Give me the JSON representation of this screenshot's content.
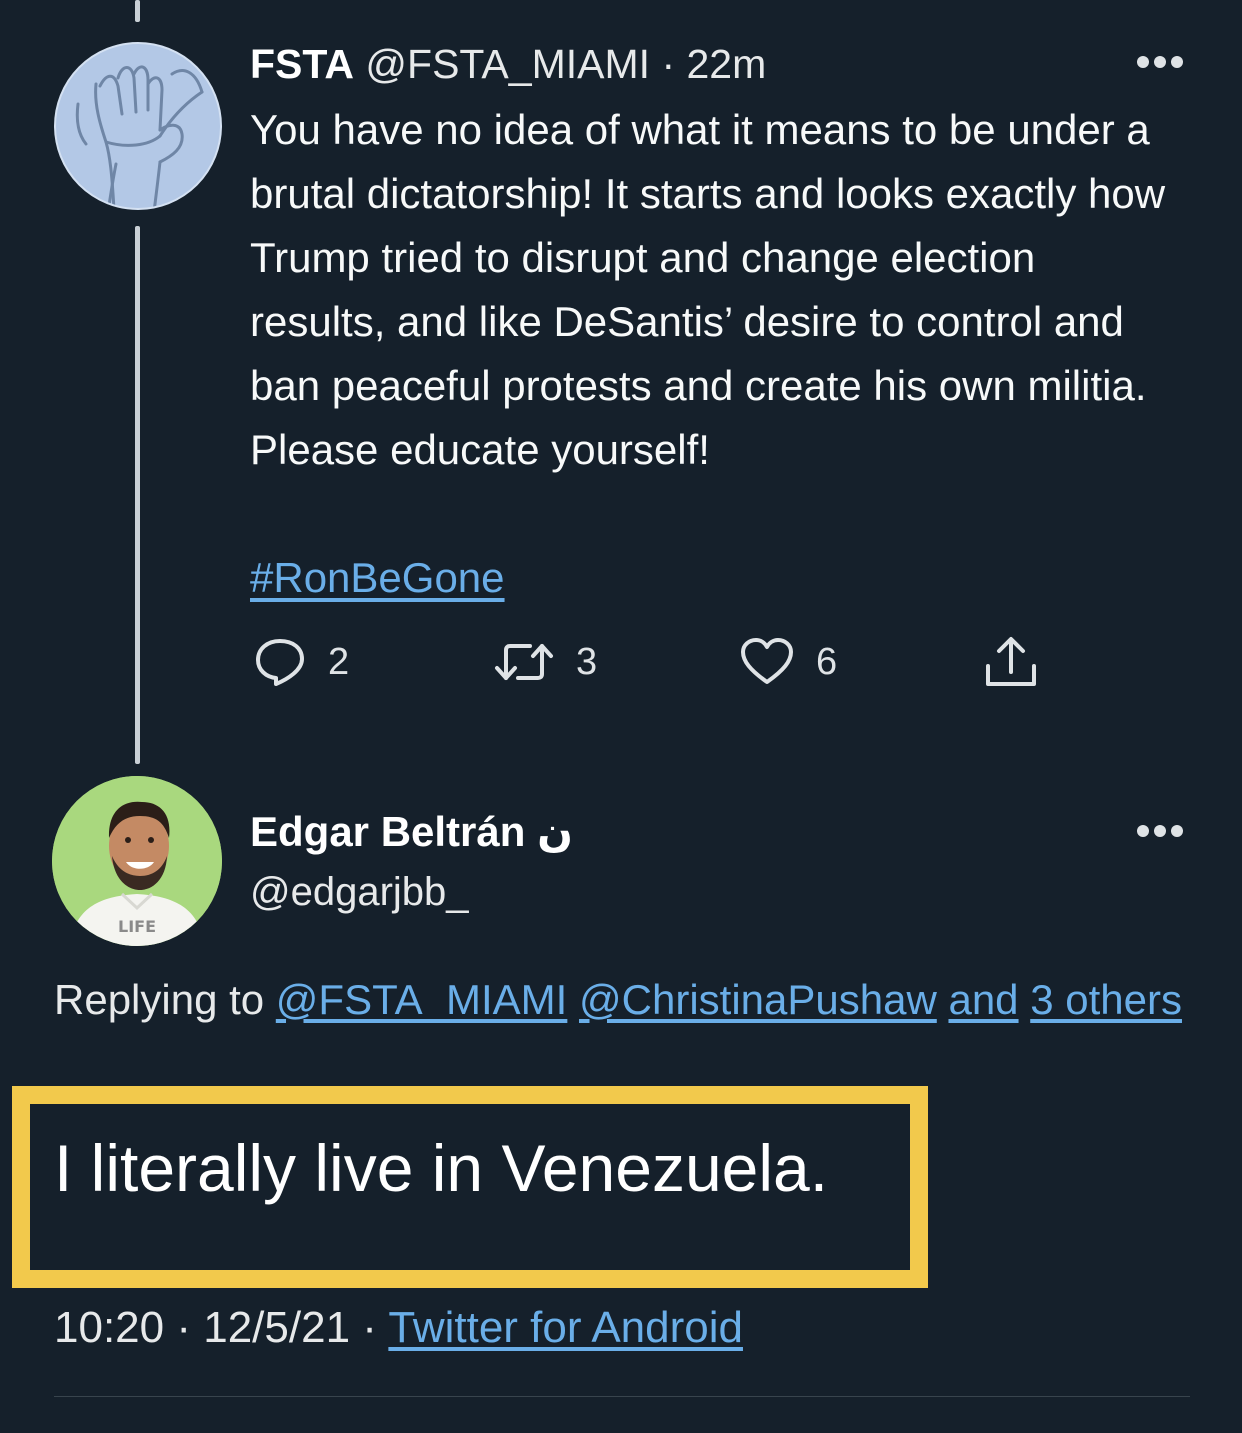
{
  "colors": {
    "background": "#15202b",
    "link": "#6aaee8",
    "highlight": "#f2c94c",
    "text": "#f7f9f9"
  },
  "tweet": {
    "author_name": "FSTA",
    "author_handle": "@FSTA_MIAMI",
    "separator": "·",
    "time": "22m",
    "text": "You have no idea of what it means to be under a brutal dictatorship! It starts and looks exactly how Trump tried to disrupt and change election results, and like DeSantis’ desire to control and ban peaceful protests and create his own militia. Please educate yourself!",
    "hashtag": "#RonBeGone",
    "replies_count": "2",
    "retweets_count": "3",
    "likes_count": "6",
    "icons": {
      "reply": "reply-bubble-icon",
      "retweet": "retweet-icon",
      "like": "heart-icon",
      "share": "share-icon",
      "more": "more-dots-icon"
    }
  },
  "reply": {
    "author_name": "Edgar Beltrán",
    "name_glyph": "ن",
    "author_handle": "@edgarjbb_",
    "replying_prefix": "Replying to",
    "mention_1": "@FSTA_MIAMI",
    "mention_2": "@ChristinaPushaw",
    "mention_rest_and": "and",
    "mention_others": "3 others",
    "text": "I literally live in Venezuela.",
    "time": "10:20",
    "date": "12/5/21",
    "source": "Twitter for Android",
    "avatar_shirt_text": "LIFE"
  }
}
